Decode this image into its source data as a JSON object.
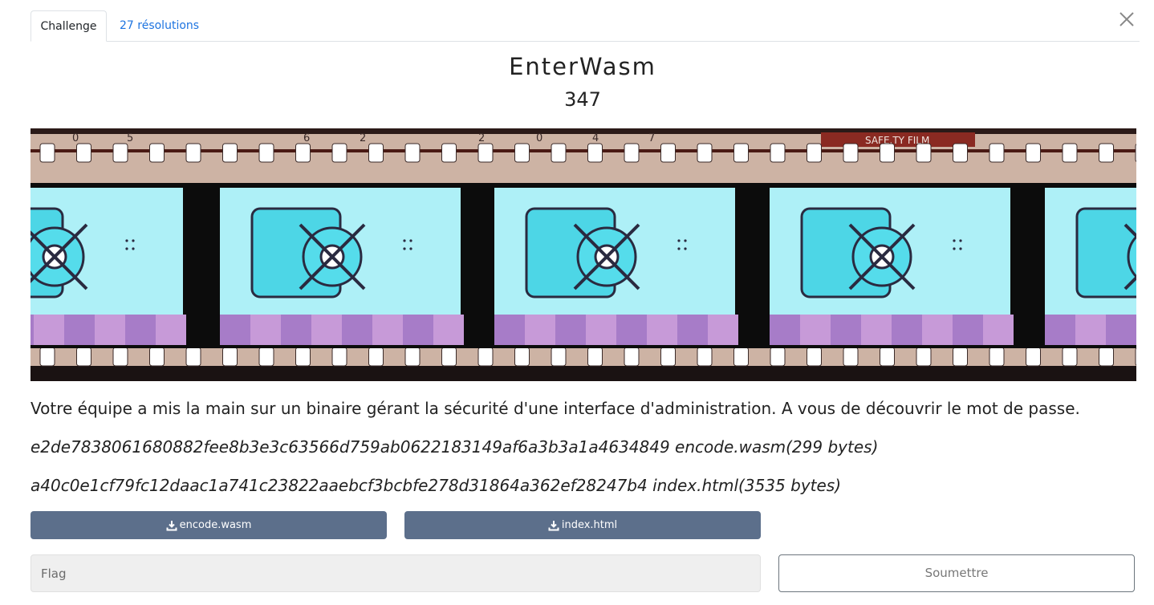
{
  "tabs": [
    {
      "label": "Challenge",
      "active": true
    },
    {
      "label": "27 résolutions",
      "active": false
    }
  ],
  "challenge": {
    "name": "EnterWasm",
    "points": "347",
    "description": "Votre équipe a mis la main sur un binaire gérant la sécurité d'une interface d'administration. A vous de découvrir le mot de passe.",
    "files": [
      {
        "hash_line": "e2de7838061680882fee8b3e3c63566d759ab0622183149af6a3b3a1a4634849 encode.wasm(299 bytes)",
        "button_label": "encode.wasm"
      },
      {
        "hash_line": "a40c0e1cf79fc12daac1a741c23822aaebcf3bcbfe278d31864a362ef28247b4 index.html(3535 bytes)",
        "button_label": "index.html"
      }
    ]
  },
  "banner": {
    "film_text": "SAFE.TY FILM",
    "frame_numbers": [
      "0",
      "5",
      "6",
      "2",
      "2",
      "0",
      "4",
      "7"
    ]
  },
  "form": {
    "flag_placeholder": "Flag",
    "submit_label": "Soumettre"
  },
  "colors": {
    "link": "#1e74e0",
    "download_button": "#5c6f8b",
    "film_base": "#cdb3a4",
    "vault_cyan": "#4dd6e6"
  },
  "icons": [
    "close-icon",
    "download-icon"
  ]
}
